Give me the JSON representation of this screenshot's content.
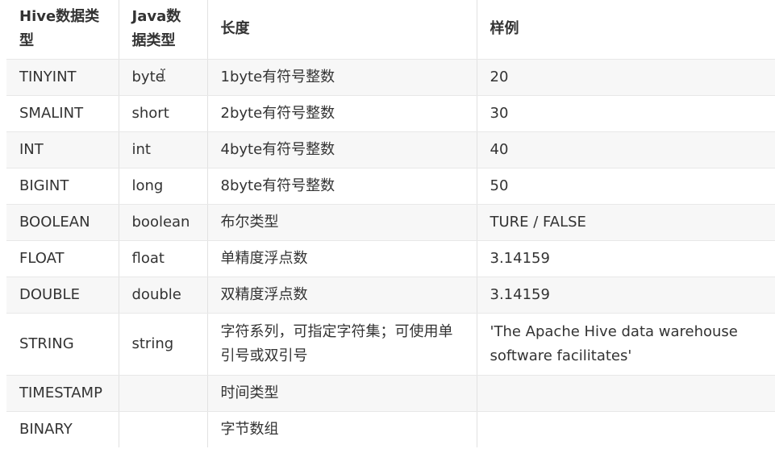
{
  "table": {
    "headers": [
      "Hive数据类型",
      "Java数据类型",
      "长度",
      "样例"
    ],
    "rows": [
      [
        "TINYINT",
        "byte",
        "1byte有符号整数",
        "20"
      ],
      [
        "SMALINT",
        "short",
        "2byte有符号整数",
        "30"
      ],
      [
        "INT",
        "int",
        "4byte有符号整数",
        "40"
      ],
      [
        "BIGINT",
        "long",
        "8byte有符号整数",
        "50"
      ],
      [
        "BOOLEAN",
        "boolean",
        "布尔类型",
        "TURE / FALSE"
      ],
      [
        "FLOAT",
        "float",
        "单精度浮点数",
        "3.14159"
      ],
      [
        "DOUBLE",
        "double",
        "双精度浮点数",
        "3.14159"
      ],
      [
        "STRING",
        "string",
        "字符系列，可指定字符集；可使用单引号或双引号",
        "'The Apache Hive data warehouse software facilitates'"
      ],
      [
        "TIMESTAMP",
        "",
        "时间类型",
        ""
      ],
      [
        "BINARY",
        "",
        "字节数组",
        ""
      ]
    ]
  }
}
